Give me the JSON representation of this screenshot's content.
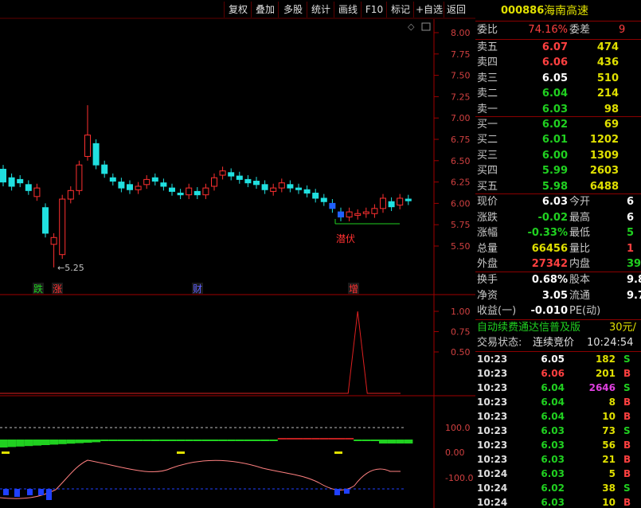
{
  "toolbar": {
    "buttons": [
      "复权",
      "叠加",
      "多股",
      "统计",
      "画线",
      "F10",
      "标记",
      "+自选",
      "返回"
    ]
  },
  "stock": {
    "code": "000886",
    "name": "海南高速"
  },
  "order_ratio": {
    "weibi_label": "委比",
    "weibi": "74.16%",
    "weicha_label": "委差",
    "weicha": "9"
  },
  "asks": [
    {
      "label": "卖五",
      "price": "6.07",
      "vol": "474"
    },
    {
      "label": "卖四",
      "price": "6.06",
      "vol": "436"
    },
    {
      "label": "卖三",
      "price": "6.05",
      "vol": "510"
    },
    {
      "label": "卖二",
      "price": "6.04",
      "vol": "214"
    },
    {
      "label": "卖一",
      "price": "6.03",
      "vol": "98"
    }
  ],
  "bids": [
    {
      "label": "买一",
      "price": "6.02",
      "vol": "69"
    },
    {
      "label": "买二",
      "price": "6.01",
      "vol": "1202"
    },
    {
      "label": "买三",
      "price": "6.00",
      "vol": "1309"
    },
    {
      "label": "买四",
      "price": "5.99",
      "vol": "2603"
    },
    {
      "label": "买五",
      "price": "5.98",
      "vol": "6488"
    }
  ],
  "quote": [
    {
      "l1": "现价",
      "v1": "6.03",
      "l2": "今开",
      "v2": "6"
    },
    {
      "l1": "涨跌",
      "v1": "-0.02",
      "l2": "最高",
      "v2": "6"
    },
    {
      "l1": "涨幅",
      "v1": "-0.33%",
      "l2": "最低",
      "v2": "5"
    },
    {
      "l1": "总量",
      "v1": "66456",
      "l2": "量比",
      "v2": "1"
    },
    {
      "l1": "外盘",
      "v1": "27342",
      "l2": "内盘",
      "v2": "39"
    }
  ],
  "stats": [
    {
      "l1": "换手",
      "v1": "0.68%",
      "l2": "股本",
      "v2": "9.8"
    },
    {
      "l1": "净资",
      "v1": "3.05",
      "l2": "流通",
      "v2": "9.7"
    },
    {
      "l1": "收益(一)",
      "v1": "-0.010",
      "l2": "PE(动)",
      "v2": ""
    }
  ],
  "promo": {
    "text": "自动续费通达信普及版",
    "price": "30元/"
  },
  "trade_state": {
    "label": "交易状态:",
    "value": "连续竞价",
    "time": "10:24:54"
  },
  "ticks": [
    {
      "t": "10:23",
      "p": "6.05",
      "v": "182",
      "s": "S"
    },
    {
      "t": "10:23",
      "p": "6.06",
      "v": "201",
      "s": "B"
    },
    {
      "t": "10:23",
      "p": "6.04",
      "v": "2646",
      "s": "S"
    },
    {
      "t": "10:23",
      "p": "6.04",
      "v": "8",
      "s": "B"
    },
    {
      "t": "10:23",
      "p": "6.04",
      "v": "10",
      "s": "B"
    },
    {
      "t": "10:23",
      "p": "6.03",
      "v": "73",
      "s": "S"
    },
    {
      "t": "10:23",
      "p": "6.03",
      "v": "56",
      "s": "B"
    },
    {
      "t": "10:23",
      "p": "6.03",
      "v": "21",
      "s": "B"
    },
    {
      "t": "10:24",
      "p": "6.03",
      "v": "5",
      "s": "B"
    },
    {
      "t": "10:24",
      "p": "6.02",
      "v": "38",
      "s": "S"
    },
    {
      "t": "10:24",
      "p": "6.03",
      "v": "10",
      "s": "B"
    }
  ],
  "chart_data": {
    "type": "candlestick",
    "yticks": [
      "8.00",
      "7.75",
      "7.50",
      "7.25",
      "7.00",
      "6.75",
      "6.50",
      "6.25",
      "6.00",
      "5.75",
      "5.50"
    ],
    "low_label": "←5.25",
    "annotation": "潜伏",
    "markers": [
      {
        "text": "跌",
        "color": "#20d020"
      },
      {
        "text": "涨",
        "color": "#ff3030"
      },
      {
        "text": "财",
        "color": "#6060ff"
      },
      {
        "text": "增",
        "color": "#ff3030"
      }
    ],
    "candles": [
      {
        "o": 6.4,
        "c": 6.25
      },
      {
        "o": 6.3,
        "c": 6.2
      },
      {
        "o": 6.28,
        "c": 6.24
      },
      {
        "o": 6.22,
        "c": 6.15
      },
      {
        "o": 6.08,
        "c": 6.18
      },
      {
        "o": 5.95,
        "c": 5.65
      },
      {
        "o": 5.52,
        "c": 5.6
      },
      {
        "o": 5.4,
        "c": 6.05
      },
      {
        "o": 6.05,
        "c": 6.15
      },
      {
        "o": 6.15,
        "c": 6.45
      },
      {
        "o": 6.55,
        "c": 6.8
      },
      {
        "o": 6.7,
        "c": 6.45
      },
      {
        "o": 6.45,
        "c": 6.35
      },
      {
        "o": 6.3,
        "c": 6.26
      },
      {
        "o": 6.25,
        "c": 6.18
      },
      {
        "o": 6.22,
        "c": 6.16
      },
      {
        "o": 6.16,
        "c": 6.2
      },
      {
        "o": 6.22,
        "c": 6.28
      },
      {
        "o": 6.3,
        "c": 6.26
      },
      {
        "o": 6.24,
        "c": 6.2
      },
      {
        "o": 6.18,
        "c": 6.14
      },
      {
        "o": 6.12,
        "c": 6.1
      },
      {
        "o": 6.1,
        "c": 6.18
      },
      {
        "o": 6.14,
        "c": 6.1
      },
      {
        "o": 6.1,
        "c": 6.18
      },
      {
        "o": 6.2,
        "c": 6.3
      },
      {
        "o": 6.33,
        "c": 6.38
      },
      {
        "o": 6.36,
        "c": 6.32
      },
      {
        "o": 6.32,
        "c": 6.28
      },
      {
        "o": 6.28,
        "c": 6.24
      },
      {
        "o": 6.26,
        "c": 6.22
      },
      {
        "o": 6.22,
        "c": 6.16
      },
      {
        "o": 6.14,
        "c": 6.18
      },
      {
        "o": 6.18,
        "c": 6.24
      },
      {
        "o": 6.22,
        "c": 6.18
      },
      {
        "o": 6.18,
        "c": 6.16
      },
      {
        "o": 6.16,
        "c": 6.12
      },
      {
        "o": 6.12,
        "c": 6.06
      },
      {
        "o": 6.06,
        "c": 6.02
      },
      {
        "o": 6.0,
        "c": 5.94
      },
      {
        "o": 5.9,
        "c": 5.84
      },
      {
        "o": 5.84,
        "c": 5.9
      },
      {
        "o": 5.86,
        "c": 5.88
      },
      {
        "o": 5.88,
        "c": 5.9
      },
      {
        "o": 5.88,
        "c": 5.94
      },
      {
        "o": 5.94,
        "c": 6.06
      },
      {
        "o": 6.02,
        "c": 5.96
      },
      {
        "o": 5.98,
        "c": 6.06
      },
      {
        "o": 6.05,
        "c": 6.03
      }
    ],
    "indicator1": {
      "yticks": [
        "1.00",
        "0.75",
        "0.50"
      ],
      "spike_index": 42
    },
    "indicator2": {
      "yticks": [
        "100.0",
        "0.00",
        "-100.0"
      ]
    }
  }
}
